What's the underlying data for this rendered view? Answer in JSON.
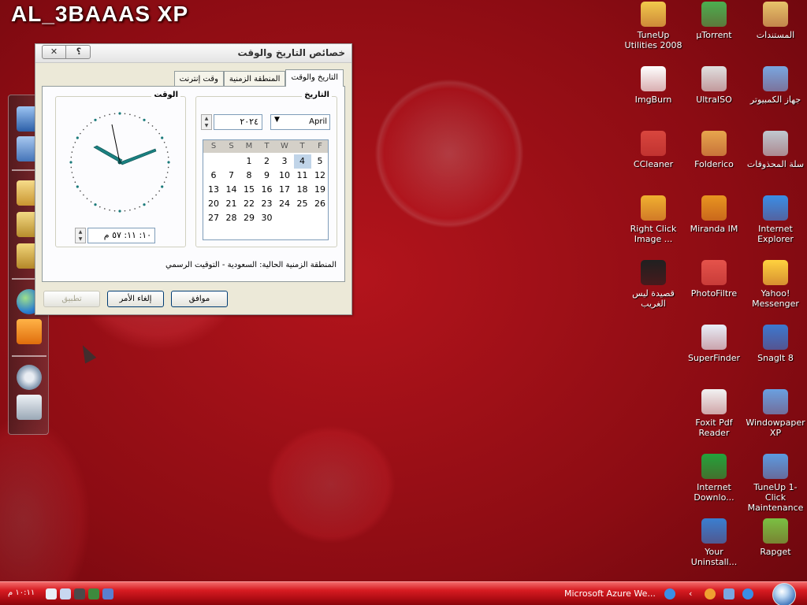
{
  "desktop": {
    "title": "AL_3BAAAS XP",
    "icons": [
      {
        "label": "TuneUp Utilities 2008",
        "icon": "tuneup-icon",
        "color": "#f2c94c"
      },
      {
        "label": "µTorrent",
        "icon": "utorrent-icon",
        "color": "#4caf50"
      },
      {
        "label": "المستندات",
        "icon": "folder-icon",
        "color": "#e8c36a"
      },
      {
        "label": "ImgBurn",
        "icon": "disc-icon",
        "color": "#ffffff"
      },
      {
        "label": "UltraISO",
        "icon": "cd-icon",
        "color": "#e0e0e0"
      },
      {
        "label": "جهاز الكمبيوتر",
        "icon": "computer-icon",
        "color": "#7aa7e0"
      },
      {
        "label": "CCleaner",
        "icon": "ccleaner-icon",
        "color": "#d9463e"
      },
      {
        "label": "Folderico",
        "icon": "folder-icon",
        "color": "#e7a64d"
      },
      {
        "label": "سلة المحذوفات",
        "icon": "recycle-bin-icon",
        "color": "#c0c8d0"
      },
      {
        "label": "Right Click Image ...",
        "icon": "image-icon",
        "color": "#f0b030"
      },
      {
        "label": "Miranda IM",
        "icon": "miranda-icon",
        "color": "#e89520"
      },
      {
        "label": "Internet Explorer",
        "icon": "ie-icon",
        "color": "#3a8ee6"
      },
      {
        "label": "قصيدة ليس الغريب",
        "icon": "real-player-icon",
        "color": "#202020"
      },
      {
        "label": "PhotoFiltre",
        "icon": "photofiltre-icon",
        "color": "#e5534b"
      },
      {
        "label": "Yahoo! Messenger",
        "icon": "yahoo-icon",
        "color": "#ffd23f"
      },
      {
        "label": "SuperFinder",
        "icon": "search-doc-icon",
        "color": "#e8eef8"
      },
      {
        "label": "SnagIt 8",
        "icon": "snagit-icon",
        "color": "#3c79d0"
      },
      {
        "label": "Foxit Pdf Reader",
        "icon": "pdf-icon",
        "color": "#f2f2f2"
      },
      {
        "label": "Windowpaper XP",
        "icon": "wallpaper-icon",
        "color": "#6aa0e0"
      },
      {
        "label": "Internet Downlo...",
        "icon": "download-icon",
        "color": "#23a33b"
      },
      {
        "label": "TuneUp 1-Click Maintenance",
        "icon": "maintenance-icon",
        "color": "#5c9be0"
      },
      {
        "label": "Your Uninstall...",
        "icon": "uninstall-icon",
        "color": "#3a7fd0"
      },
      {
        "label": "Rapget",
        "icon": "download-arrow-icon",
        "color": "#7ac043"
      }
    ]
  },
  "dialog": {
    "title": "خصائص التاريخ والوقت",
    "help_label": "؟",
    "close_label": "✕",
    "tabs": [
      "التاريخ والوقت",
      "المنطقة الزمنية",
      "وقت إنترنت"
    ],
    "date_group_label": "التاريخ",
    "time_group_label": "الوقت",
    "month": "April",
    "year": "٢٠٢٤",
    "weekdays": [
      "S",
      "S",
      "M",
      "T",
      "W",
      "T",
      "F"
    ],
    "calendar_rows": [
      [
        "",
        "",
        "1",
        "2",
        "3",
        "4",
        "5"
      ],
      [
        "6",
        "7",
        "8",
        "9",
        "10",
        "11",
        "12"
      ],
      [
        "13",
        "14",
        "15",
        "16",
        "17",
        "18",
        "19"
      ],
      [
        "20",
        "21",
        "22",
        "23",
        "24",
        "25",
        "26"
      ],
      [
        "27",
        "28",
        "29",
        "30",
        "",
        "",
        ""
      ]
    ],
    "selected_day": "4",
    "time": "١٠: ١١: ٥٧ م",
    "timezone_label": "المنطقة الزمنية الحالية:",
    "timezone_value": "السعودية - التوقيت الرسمي",
    "ok_label": "موافق",
    "cancel_label": "إلغاء الأمر",
    "apply_label": "تطبيق"
  },
  "taskbar": {
    "clock": "١٠:١١ م",
    "task_label": "Microsoft Azure We...",
    "accent": "#d81c22"
  }
}
